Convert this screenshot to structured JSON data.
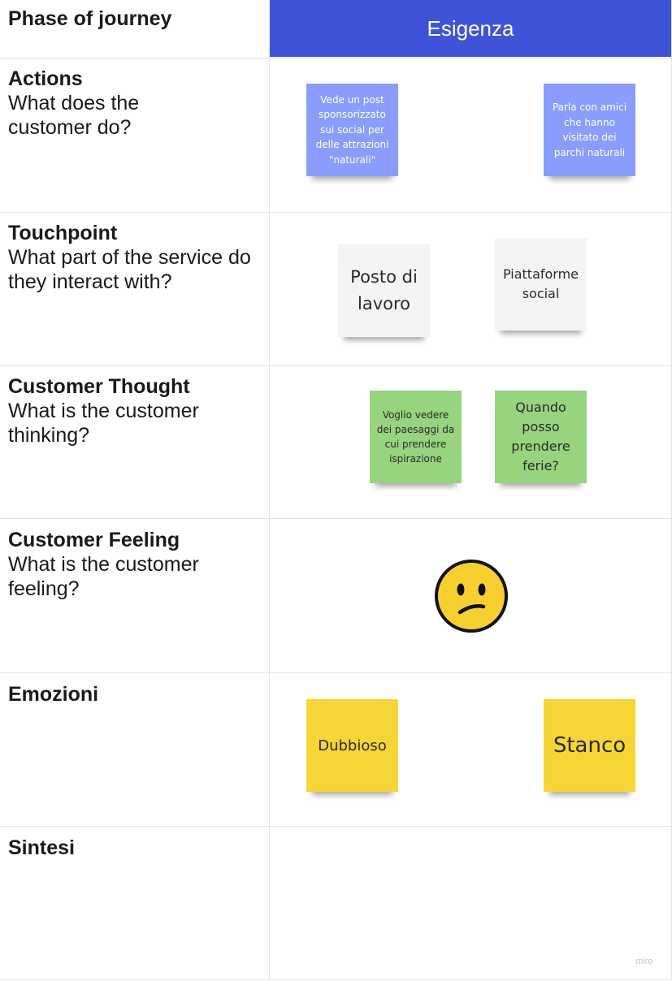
{
  "header": {
    "corner_label": "Phase of journey",
    "phase_label": "Esigenza",
    "phase_color": "#3e54d8"
  },
  "rows": [
    {
      "title": "Actions",
      "subtitle": "What does the customer do?"
    },
    {
      "title": "Touchpoint",
      "subtitle": "What part of the service do they interact with?"
    },
    {
      "title": "Customer Thought",
      "subtitle": "What is the customer thinking?"
    },
    {
      "title": "Customer Feeling",
      "subtitle": "What is the customer feeling?"
    },
    {
      "title": "Emozioni",
      "subtitle": ""
    },
    {
      "title": "Sintesi",
      "subtitle": ""
    }
  ],
  "stickies": {
    "actions": [
      {
        "text": "Vede un post sponsorizzato sui social per delle attrazioni \"naturali\"",
        "color": "#8a9dfc"
      },
      {
        "text": "Parla con amici che hanno visitato dei parchi naturali",
        "color": "#8a9dfc"
      }
    ],
    "touchpoint": [
      {
        "text": "Posto di lavoro",
        "color": "#f4f4f4"
      },
      {
        "text": "Piattaforme social",
        "color": "#f4f4f4"
      }
    ],
    "thought": [
      {
        "text": "Voglio vedere dei paesaggi da cui prendere ispirazione",
        "color": "#96d47d"
      },
      {
        "text": "Quando posso prendere ferie?",
        "color": "#96d47d"
      }
    ],
    "emozioni": [
      {
        "text": "Dubbioso",
        "color": "#f7d536"
      },
      {
        "text": "Stanco",
        "color": "#f7d536"
      }
    ]
  },
  "feeling": {
    "icon": "confused-face-icon"
  },
  "watermark": "miro"
}
